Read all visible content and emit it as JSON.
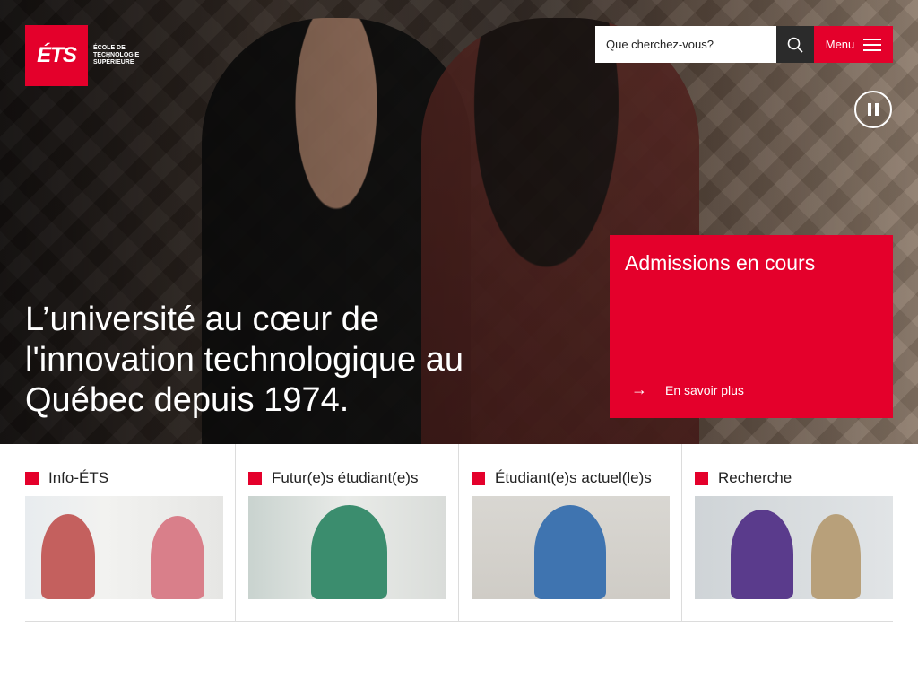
{
  "header": {
    "logo": {
      "mark": "ÉTS",
      "name_lines": [
        "ÉCOLE DE",
        "TECHNOLOGIE",
        "SUPÉRIEURE"
      ]
    },
    "search": {
      "placeholder": "Que cherchez-vous?",
      "icon": "search-icon"
    },
    "menu": {
      "label": "Menu",
      "icon": "hamburger-icon"
    }
  },
  "hero": {
    "headline": "L’université au cœur de l'innovation technologique au Québec depuis 1974.",
    "pause_icon": "pause-icon",
    "admissions": {
      "title": "Admissions en cours",
      "link_label": "En savoir plus",
      "icon": "arrow-right-icon"
    }
  },
  "tiles": [
    {
      "label": "Info-ÉTS"
    },
    {
      "label": "Futur(e)s étudiant(e)s"
    },
    {
      "label": "Étudiant(e)s actuel(le)s"
    },
    {
      "label": "Recherche"
    }
  ],
  "colors": {
    "accent": "#e4002b",
    "dark": "#2b2b2b"
  }
}
